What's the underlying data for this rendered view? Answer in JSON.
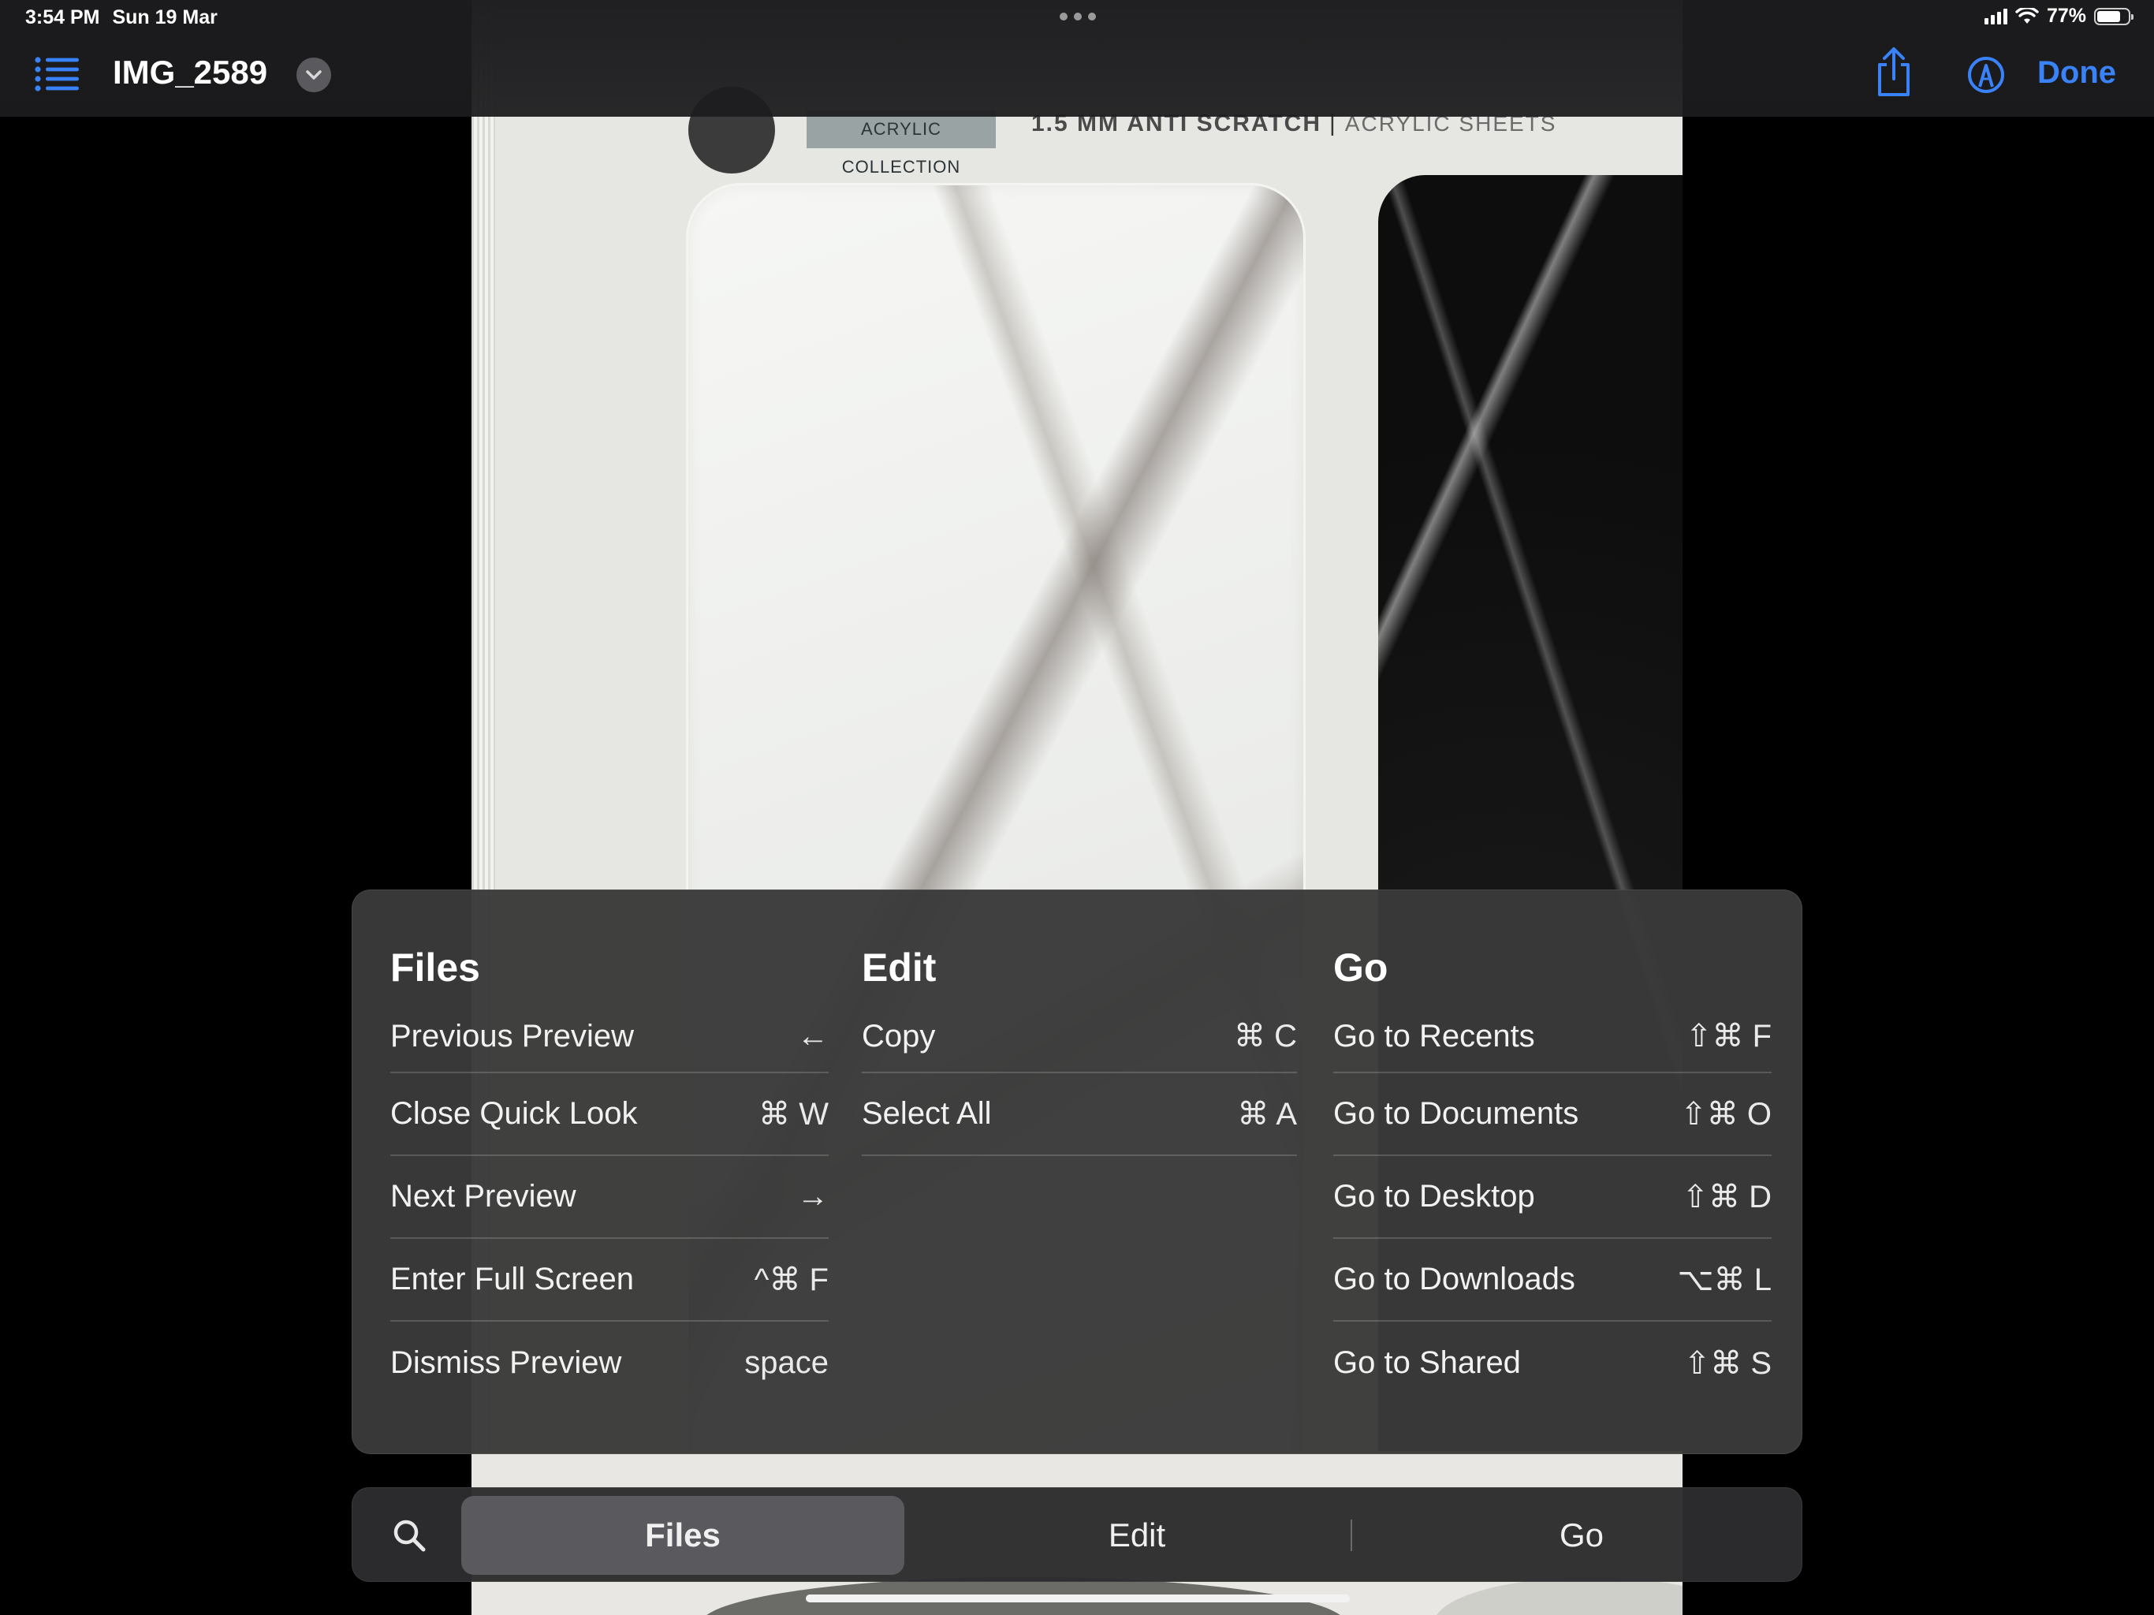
{
  "status_bar": {
    "time": "3:54 PM",
    "date": "Sun 19 Mar",
    "battery_percent": "77%",
    "battery_level": 0.77
  },
  "toolbar": {
    "title": "IMG_2589",
    "done_label": "Done",
    "accent_color": "#3a82f7"
  },
  "photo": {
    "collection_label": "ACRYLIC COLLECTION",
    "product_bold": "1.5 MM ANTI SCRATCH",
    "product_light": "ACRYLIC SHEETS"
  },
  "shortcuts": {
    "files": {
      "heading": "Files",
      "items": [
        {
          "label": "Previous Preview",
          "keys": "←"
        },
        {
          "label": "Close Quick Look",
          "keys": "⌘ W"
        },
        {
          "label": "Next Preview",
          "keys": "→"
        },
        {
          "label": "Enter Full Screen",
          "keys": "^⌘ F"
        },
        {
          "label": "Dismiss Preview",
          "keys": "space"
        }
      ]
    },
    "edit": {
      "heading": "Edit",
      "items": [
        {
          "label": "Copy",
          "keys": "⌘ C"
        },
        {
          "label": "Select All",
          "keys": "⌘ A"
        }
      ]
    },
    "go": {
      "heading": "Go",
      "items": [
        {
          "label": "Go to Recents",
          "keys": "⇧⌘ F"
        },
        {
          "label": "Go to Documents",
          "keys": "⇧⌘ O"
        },
        {
          "label": "Go to Desktop",
          "keys": "⇧⌘ D"
        },
        {
          "label": "Go to Downloads",
          "keys": "⌥⌘ L"
        },
        {
          "label": "Go to Shared",
          "keys": "⇧⌘ S"
        }
      ]
    }
  },
  "tabbar": {
    "tabs": [
      "Files",
      "Edit",
      "Go"
    ],
    "selected": "Files"
  },
  "icons": {
    "list": "list-icon",
    "chevron": "chevron-down-icon",
    "share": "share-icon",
    "markup": "markup-icon",
    "search": "search-icon"
  }
}
